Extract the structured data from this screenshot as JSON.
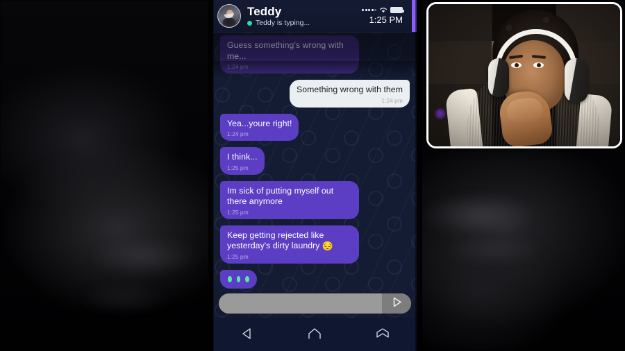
{
  "app": {
    "screen_kind": "mobile-chat-app"
  },
  "status_bar": {
    "time": "1:25 PM",
    "signal_icon": "signal-dots-icon",
    "signal_bars_filled": 4,
    "signal_bars_total": 5,
    "wifi_icon": "wifi-icon",
    "battery_icon": "battery-full-icon"
  },
  "header": {
    "contact_name": "Teddy",
    "status_text": "Teddy is typing...",
    "online_dot_color": "#2fd6c0",
    "avatar_icon": "contact-avatar",
    "accent_color": "#8b5cf6"
  },
  "conversation": {
    "messages": [
      {
        "id": "m1",
        "direction": "in",
        "text": "Guess something's wrong with me...",
        "time": "1:24 pm",
        "shadowed": true
      },
      {
        "id": "m2",
        "direction": "out",
        "text": "Something wrong with them",
        "time": "1:24 pm",
        "shadowed": false
      },
      {
        "id": "m3",
        "direction": "in",
        "text": "Yea...youre right!",
        "time": "1:24 pm",
        "shadowed": false
      },
      {
        "id": "m4",
        "direction": "in",
        "text": "I think...",
        "time": "1:25 pm",
        "shadowed": false
      },
      {
        "id": "m5",
        "direction": "in",
        "text": "Im sick of putting myself out there anymore",
        "time": "1:25 pm",
        "shadowed": false
      },
      {
        "id": "m6",
        "direction": "in",
        "text": "Keep getting rejected like yesterday's dirty laundry ",
        "emoji": "😔",
        "time": "1:25 pm",
        "shadowed": false
      }
    ],
    "typing_indicator": {
      "visible": true,
      "dot_count": 3,
      "dot_color": "#5ce6a8",
      "bubble_color": "#5b3ec4"
    },
    "incoming_bubble_color": "#5b3ec4",
    "outgoing_bubble_color": "#eceff1",
    "wallpaper_color": "#141c33"
  },
  "composer": {
    "input_value": "",
    "placeholder": "",
    "send_icon": "send-arrow-icon",
    "pill_color": "#9a9a9a"
  },
  "navbar": {
    "buttons": [
      {
        "name": "back",
        "icon": "back-triangle-icon"
      },
      {
        "name": "home",
        "icon": "home-icon"
      },
      {
        "name": "recents",
        "icon": "recents-icon"
      }
    ]
  },
  "facecam": {
    "description": "webcam-overlay",
    "border_color": "#ffffff"
  }
}
